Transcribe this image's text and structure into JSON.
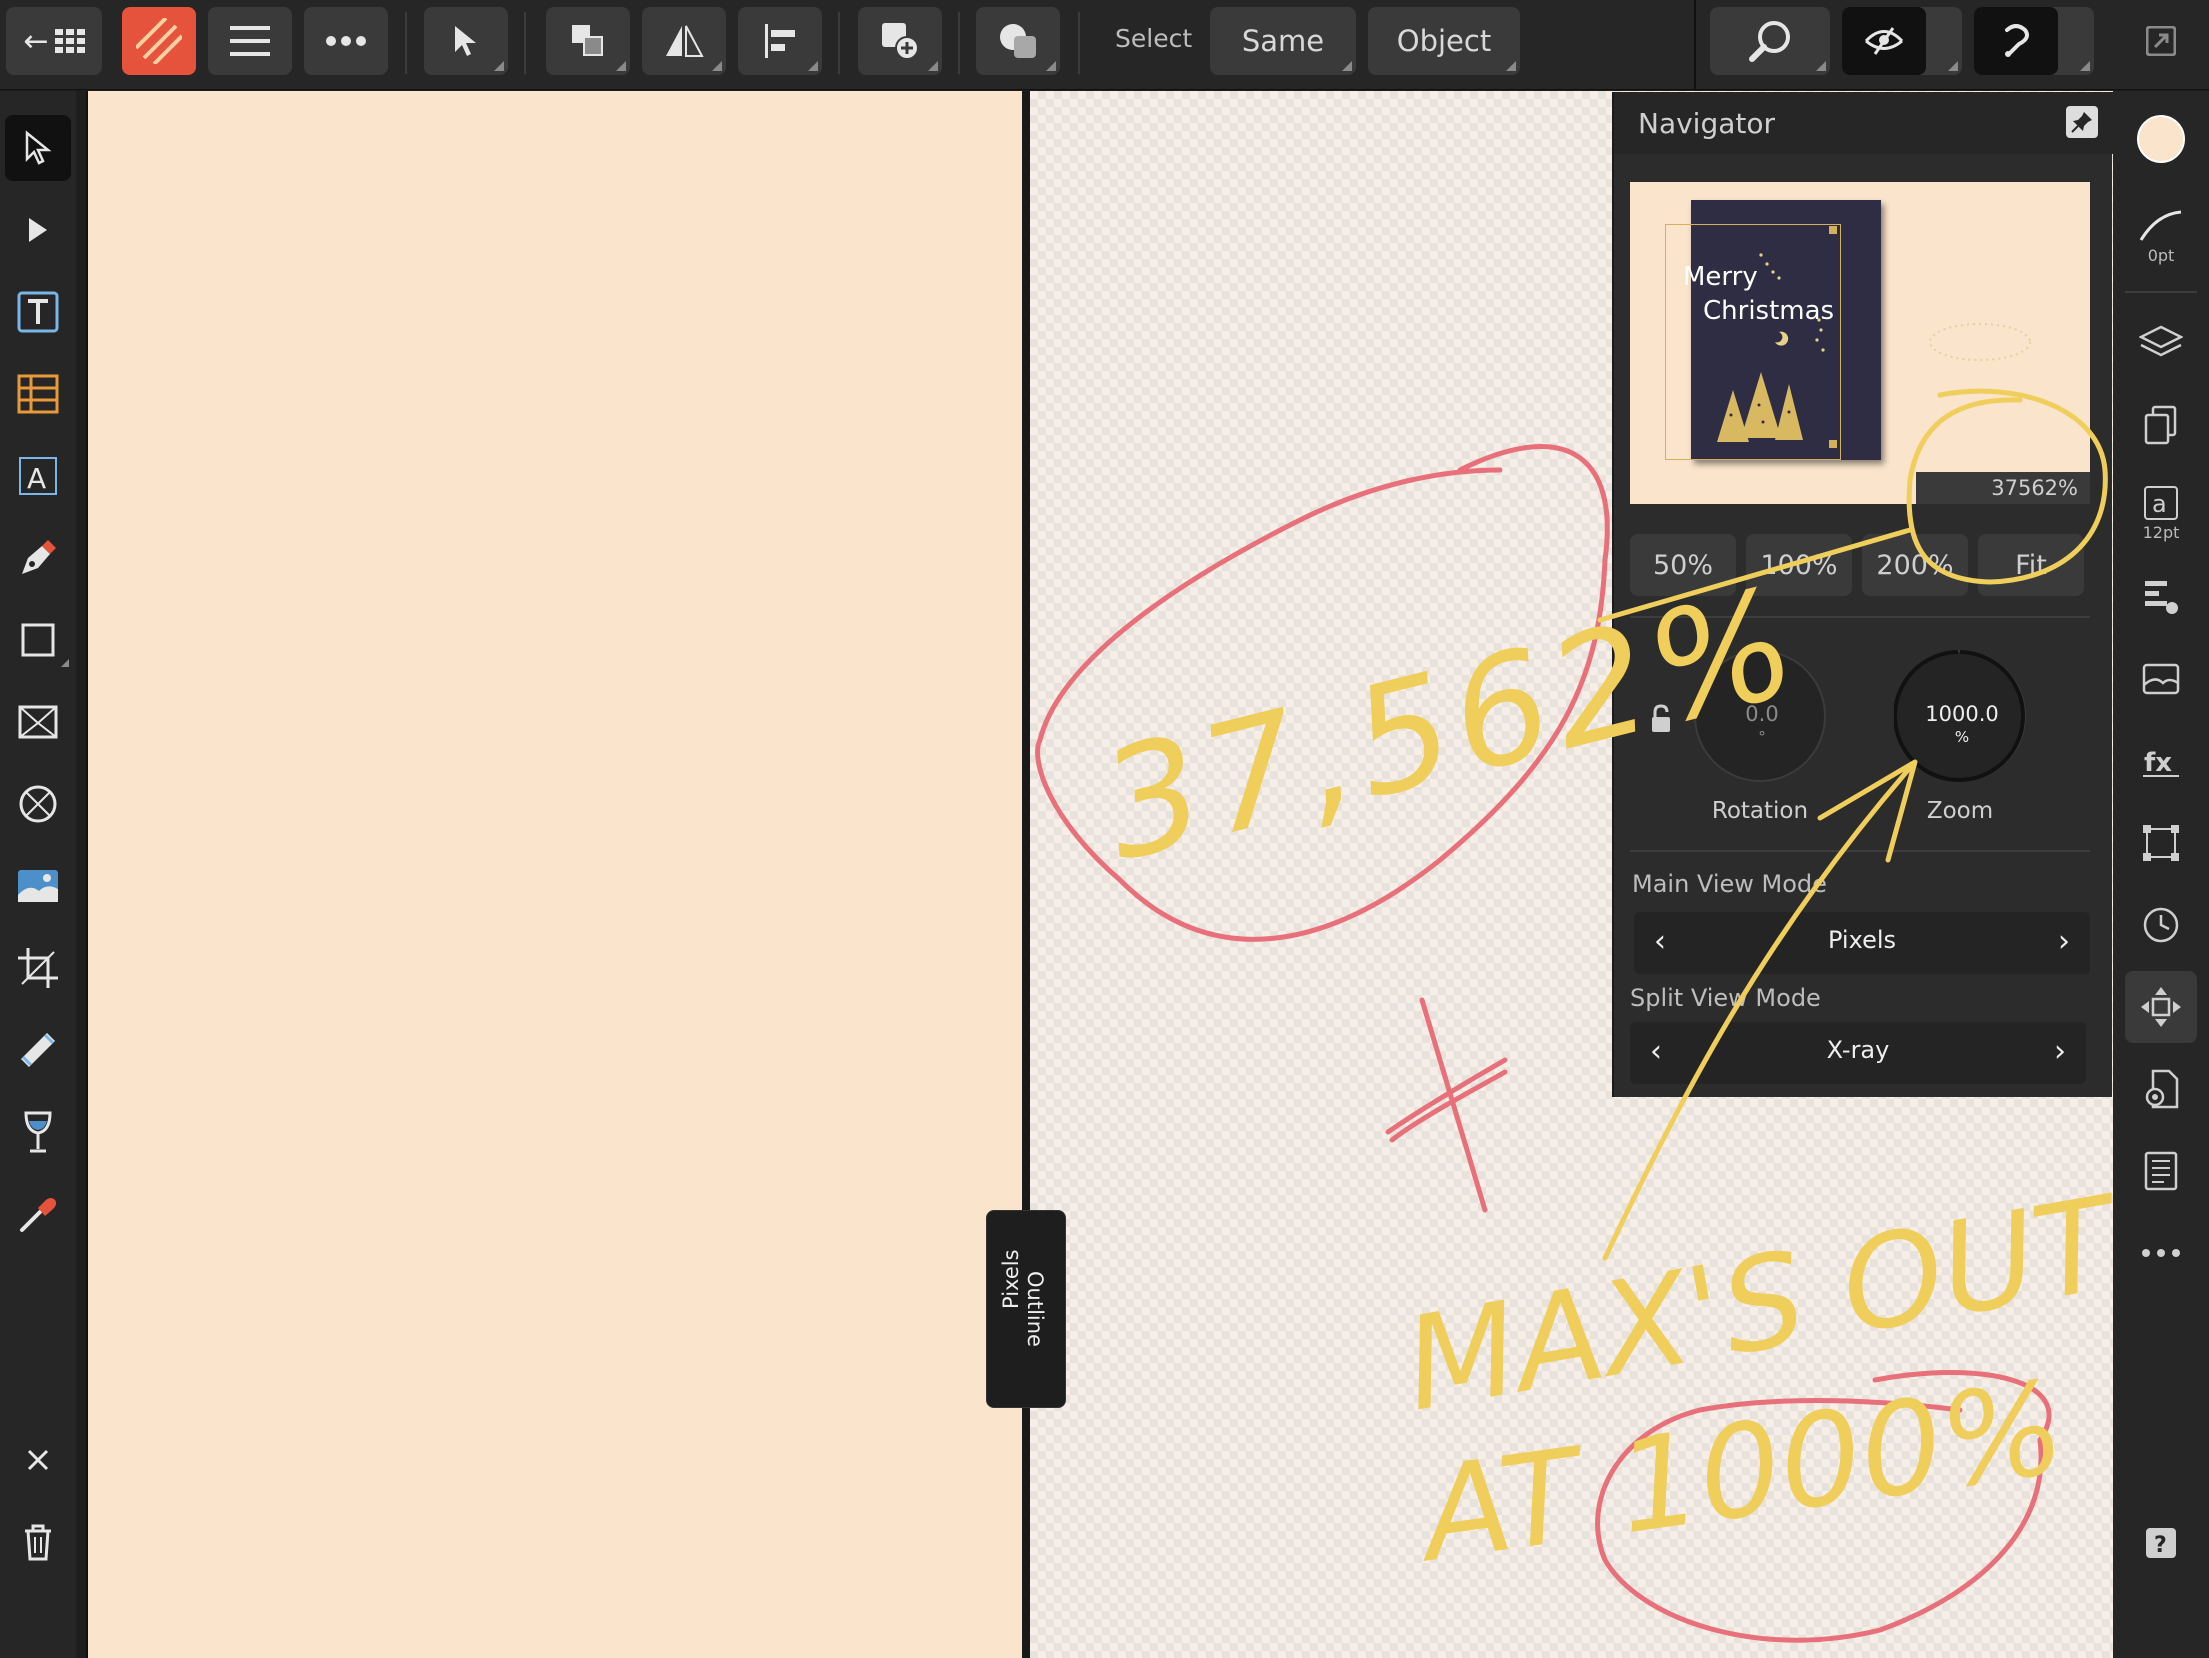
{
  "toolbar": {
    "back_label": "←",
    "select_label": "Select",
    "same_label": "Same",
    "object_label": "Object"
  },
  "navigator": {
    "title": "Navigator",
    "preview": {
      "card_line1": "Merry",
      "card_line2": "Christmas",
      "zoom_readout": "37562%"
    },
    "zoom_presets": [
      "50%",
      "100%",
      "200%",
      "Fit"
    ],
    "rotation": {
      "value": "0.0",
      "unit": "°",
      "label": "Rotation"
    },
    "zoom": {
      "value": "1000.0",
      "unit": "%",
      "label": "Zoom"
    },
    "main_view_mode": {
      "label": "Main View Mode",
      "value": "Pixels"
    },
    "split_view_mode": {
      "label": "Split View Mode",
      "value": "X-ray"
    }
  },
  "split_handle": {
    "left_label": "Pixels",
    "right_label": "Outline"
  },
  "studio": {
    "stroke_width": "0pt",
    "text_size": "12pt",
    "fill_color": "#fae4cc"
  },
  "annotations": {
    "note_left": "37,562%",
    "note_bottom_line1": "MAX'S OUT",
    "note_bottom_line2": "AT 1000%",
    "pen_yellow": "#f0ce5c",
    "pen_red": "#e8707a"
  },
  "colors": {
    "app_accent": "#e5533c",
    "canvas_bg": "#fae4cc",
    "card_bg": "#2f2d43",
    "gold": "#d3b05e"
  }
}
